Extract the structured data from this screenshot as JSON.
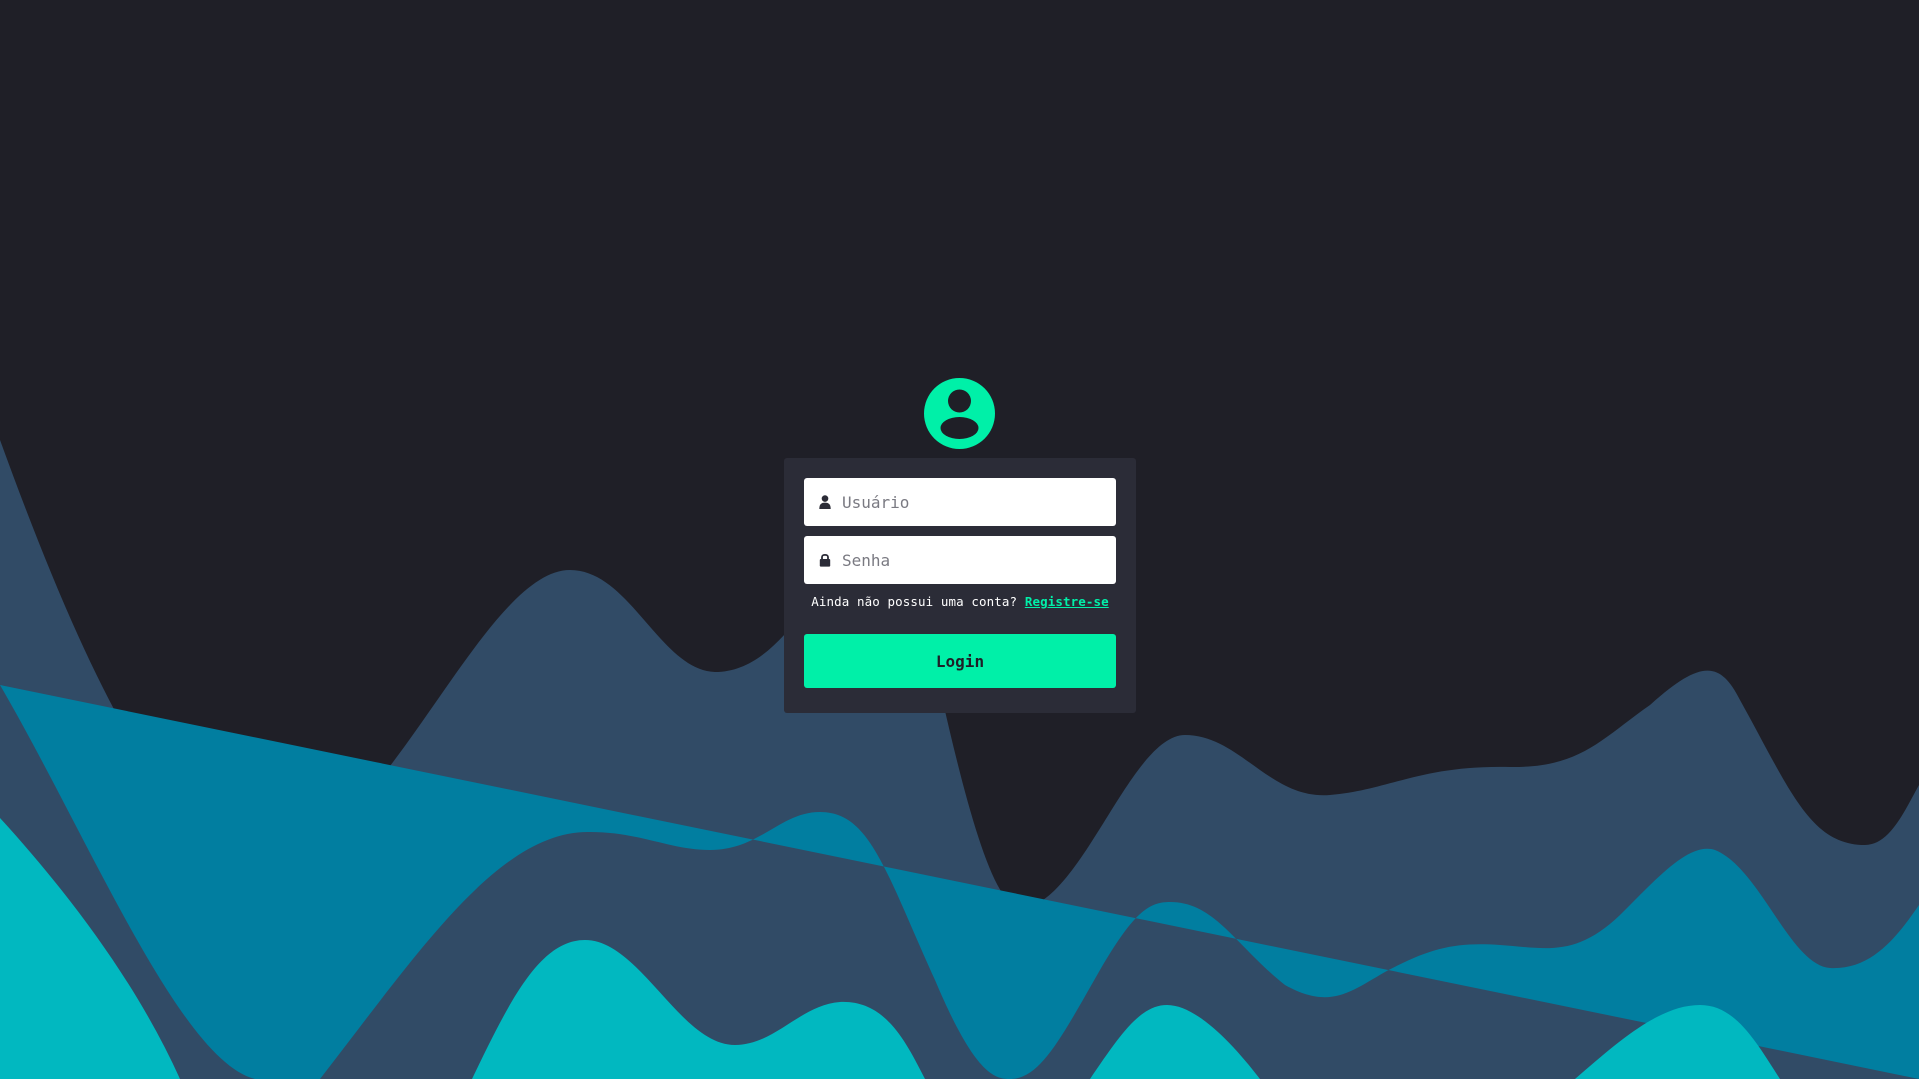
{
  "colors": {
    "background": "#1f1f27",
    "card": "#2b2c37",
    "accent": "#00f0a8",
    "wave_back": "#314b66",
    "wave_mid": "#017ea0",
    "wave_front": "#01b8c0"
  },
  "avatar": {
    "icon": "user-circle-icon"
  },
  "form": {
    "username": {
      "icon": "user-icon",
      "placeholder": "Usuário",
      "value": ""
    },
    "password": {
      "icon": "lock-icon",
      "placeholder": "Senha",
      "value": ""
    },
    "register_prompt": "Ainda não possui uma conta?",
    "register_link": "Registre-se",
    "login_label": "Login"
  }
}
